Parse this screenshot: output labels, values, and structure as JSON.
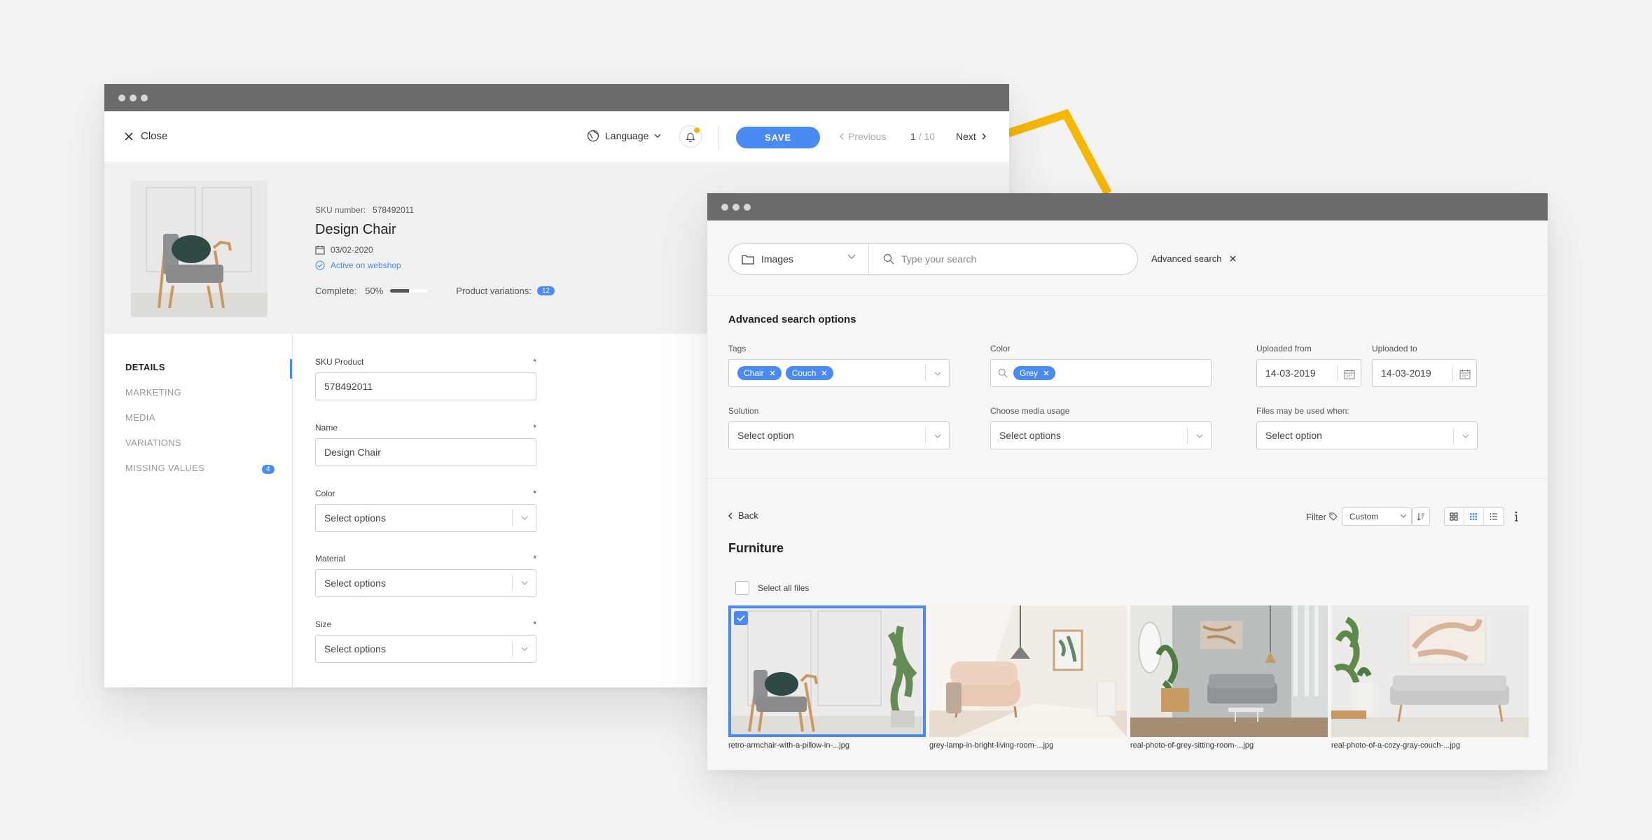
{
  "colors": {
    "accent": "#4a8af4",
    "yellow": "#f5b700",
    "titlebar": "#6b6b6b"
  },
  "editor": {
    "close_label": "Close",
    "language_label": "Language",
    "save_label": "SAVE",
    "previous_label": "Previous",
    "page_current": "1",
    "page_total": "/ 10",
    "next_label": "Next",
    "product": {
      "sku_label": "SKU number:",
      "sku_value": "578492011",
      "title": "Design Chair",
      "date": "03/02-2020",
      "status": "Active on webshop",
      "complete_label": "Complete:",
      "complete_value": "50%",
      "complete_fraction": 0.5,
      "variations_label": "Product variations:",
      "variations_count": "12"
    },
    "nav": [
      {
        "label": "DETAILS"
      },
      {
        "label": "MARKETING"
      },
      {
        "label": "MEDIA"
      },
      {
        "label": "VARIATIONS"
      },
      {
        "label": "MISSING VALUES",
        "badge": "4"
      }
    ],
    "fields": {
      "sku": {
        "label": "SKU Product",
        "value": "578492011"
      },
      "name": {
        "label": "Name",
        "value": "Design Chair"
      },
      "color": {
        "label": "Color",
        "placeholder": "Select options"
      },
      "material": {
        "label": "Material",
        "placeholder": "Select options"
      },
      "size": {
        "label": "Size",
        "placeholder": "Select options"
      }
    },
    "required_mark": "*"
  },
  "media": {
    "source_label": "Images",
    "search_placeholder": "Type your search",
    "advanced_label": "Advanced search",
    "advanced_title": "Advanced search options",
    "tags": {
      "label": "Tags",
      "items": [
        "Chair",
        "Couch"
      ]
    },
    "color": {
      "label": "Color",
      "items": [
        "Grey"
      ]
    },
    "uploaded_from": {
      "label": "Uploaded from",
      "value": "14-03-2019"
    },
    "uploaded_to": {
      "label": "Uploaded to",
      "value": "14-03-2019"
    },
    "solution": {
      "label": "Solution",
      "placeholder": "Select option"
    },
    "usage": {
      "label": "Choose media usage",
      "placeholder": "Select options"
    },
    "allowed": {
      "label": "Files may be used when:",
      "placeholder": "Select option"
    },
    "back_label": "Back",
    "filter_label": "Filter",
    "sort_value": "Custom",
    "folder_title": "Furniture",
    "select_all_label": "Select all files",
    "files": [
      {
        "name": "retro-armchair-with-a-pillow-in-...jpg",
        "selected": true
      },
      {
        "name": "grey-lamp-in-bright-living-room-...jpg",
        "selected": false
      },
      {
        "name": "real-photo-of-grey-sitting-room-...jpg",
        "selected": false
      },
      {
        "name": "real-photo-of-a-cozy-gray-couch-...jpg",
        "selected": false
      }
    ]
  }
}
